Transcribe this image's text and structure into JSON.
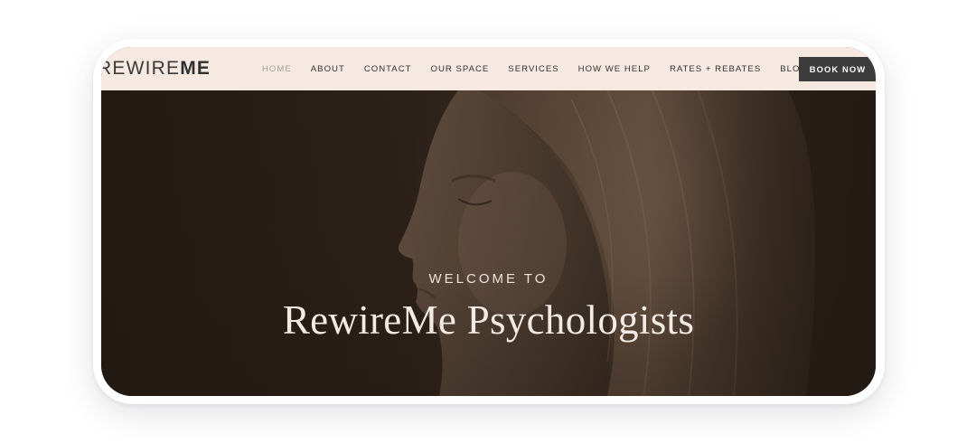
{
  "brand": {
    "logo_light": "REWIRE",
    "logo_bold": "ME"
  },
  "nav": {
    "items": [
      {
        "label": "HOME",
        "active": true
      },
      {
        "label": "ABOUT",
        "active": false
      },
      {
        "label": "CONTACT",
        "active": false
      },
      {
        "label": "OUR SPACE",
        "active": false
      },
      {
        "label": "SERVICES",
        "active": false
      },
      {
        "label": "HOW WE HELP",
        "active": false
      },
      {
        "label": "RATES + REBATES",
        "active": false
      },
      {
        "label": "BLOG",
        "active": false
      }
    ],
    "cta_label": "BOOK NOW"
  },
  "hero": {
    "eyebrow": "WELCOME TO",
    "title": "RewireMe Psychologists",
    "image_icon": "portrait-photo"
  },
  "colors": {
    "nav_background": "#f6e9e2",
    "cta_background": "#3c3c3c",
    "hero_background": "#2b2118",
    "active_nav": "#a9a09a"
  }
}
